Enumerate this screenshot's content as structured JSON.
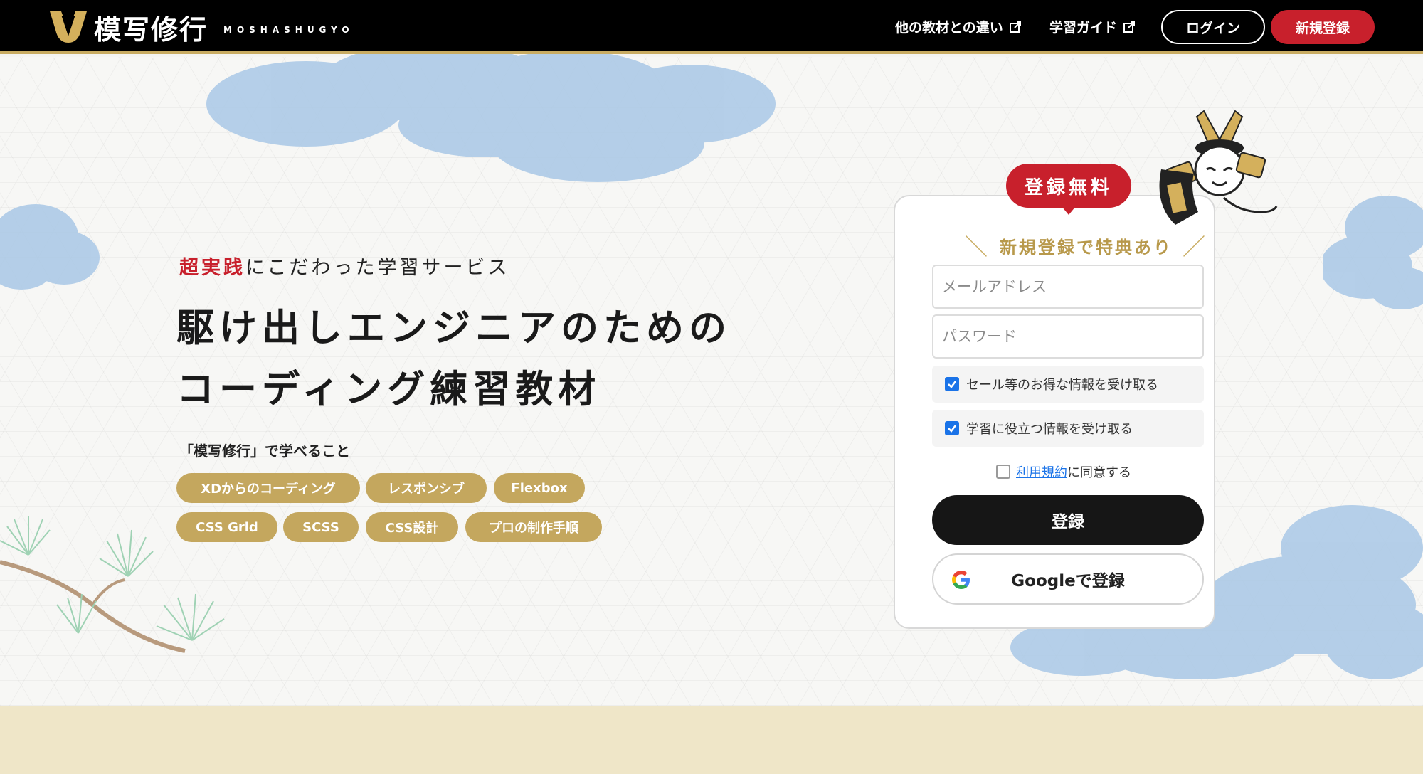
{
  "header": {
    "logo_text": "模写修行",
    "logo_sub": "MOSHASHUGYO",
    "nav": [
      {
        "label": "他の教材との違い"
      },
      {
        "label": "学習ガイド"
      }
    ],
    "login_label": "ログイン",
    "signup_label": "新規登録"
  },
  "hero": {
    "tagline_highlight": "超実践",
    "tagline_rest": "にこだわった学習サービス",
    "headline_line1": "駆け出しエンジニアのための",
    "headline_line2": "コーディング練習教材",
    "learn_label": "「模写修行」で学べること",
    "tags": [
      "XDからのコーディング",
      "レスポンシブ",
      "Flexbox",
      "CSS Grid",
      "SCSS",
      "CSS設計",
      "プロの制作手順"
    ]
  },
  "form": {
    "badge": "登録無料",
    "benefit_text": "新規登録で特典あり",
    "email_placeholder": "メールアドレス",
    "password_placeholder": "パスワード",
    "checkboxes": [
      {
        "label": "セール等のお得な情報を受け取る",
        "checked": true
      },
      {
        "label": "学習に役立つ情報を受け取る",
        "checked": true
      }
    ],
    "terms_link": "利用規約",
    "terms_rest": "に同意する",
    "terms_checked": false,
    "register_label": "登録",
    "google_label": "Googleで登録"
  },
  "colors": {
    "accent_red": "#c8202c",
    "gold": "#c4a75e",
    "dark": "#161616",
    "link_blue": "#1a73e8"
  }
}
